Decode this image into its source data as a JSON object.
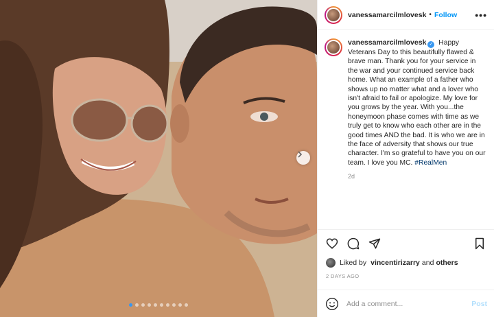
{
  "post": {
    "username": "vanessamarcilmlovesk",
    "header_separator": "•",
    "follow_label": "Follow",
    "more_label": "•••",
    "caption_text": "Happy Veterans Day to this beautifully flawed & brave man. Thank you for your service in the war and your continued service back home. What an example of a father who shows up no matter what and a lover who isn't afraid to fail or apologize. My love for you grows by the year. With you...the honeymoon phase comes with time as we truly get to know who each other are in the good times AND the bad. It is who we are in the face of adversity that shows our true character. I'm so grateful to have you on our team. I love you MC.",
    "hashtag": "#RealMen",
    "caption_age": "2d",
    "verified_mark": "✓",
    "liked_by_prefix": "Liked by",
    "liked_by_user": "vincentirizarry",
    "liked_by_and": "and",
    "liked_by_others": "others",
    "timestamp": "2 DAYS AGO",
    "comment_placeholder": "Add a comment...",
    "post_label": "Post"
  },
  "carousel": {
    "total_slides": 10,
    "active_slide": 1
  },
  "icons": {
    "like": "heart-icon",
    "comment": "comment-icon",
    "share": "share-icon",
    "save": "bookmark-icon",
    "emoji": "emoji-icon",
    "next": "chevron-right-icon"
  },
  "colors": {
    "follow_blue": "#0095f6",
    "hashtag_blue": "#00376b",
    "post_disabled": "#b2dffc",
    "muted_gray": "#8e8e8e"
  }
}
